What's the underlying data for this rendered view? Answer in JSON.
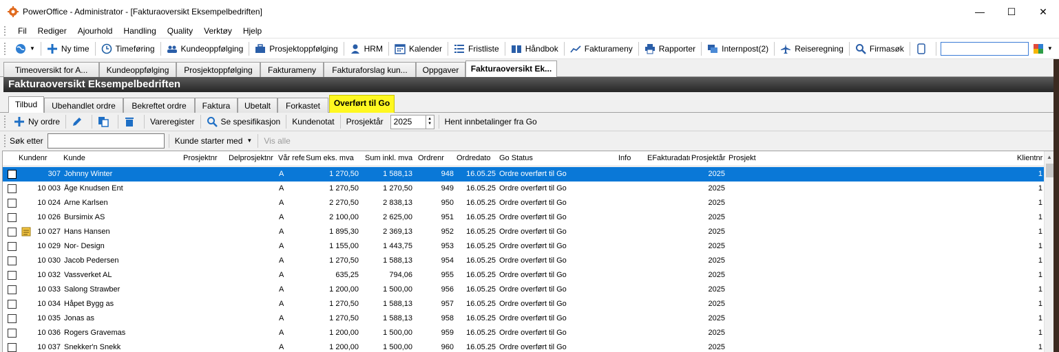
{
  "window": {
    "title": "PowerOffice - Administrator - [Fakturaoversikt Eksempelbedriften]",
    "minimize": "—",
    "maximize": "☐",
    "close": "✕"
  },
  "menu": [
    "Fil",
    "Rediger",
    "Ajourhold",
    "Handling",
    "Quality",
    "Verktøy",
    "Hjelp"
  ],
  "toolbar": {
    "items": [
      {
        "label": "Ny time",
        "icon": "plus-icon"
      },
      {
        "label": "Timeføring",
        "icon": "clock-icon"
      },
      {
        "label": "Kundeoppfølging",
        "icon": "people-icon"
      },
      {
        "label": "Prosjektoppfølging",
        "icon": "briefcase-icon"
      },
      {
        "label": "HRM",
        "icon": "person-icon"
      },
      {
        "label": "Kalender",
        "icon": "calendar-icon"
      },
      {
        "label": "Fristliste",
        "icon": "list-icon"
      },
      {
        "label": "Håndbok",
        "icon": "book-icon"
      },
      {
        "label": "Fakturameny",
        "icon": "chart-icon"
      },
      {
        "label": "Rapporter",
        "icon": "printer-icon"
      },
      {
        "label": "Internpost(2)",
        "icon": "chat-icon"
      },
      {
        "label": "Reiseregning",
        "icon": "plane-icon"
      },
      {
        "label": "Firmasøk",
        "icon": "search-icon"
      }
    ],
    "search_value": ""
  },
  "doc_tabs": [
    "Timeoversikt for A...",
    "Kundeoppfølging",
    "Prosjektoppfølging",
    "Fakturameny",
    "Fakturaforslag kun...",
    "Oppgaver",
    "Fakturaoversikt Ek..."
  ],
  "header_title": "Fakturaoversikt Eksempelbedriften",
  "sub_tabs": [
    "Tilbud",
    "Ubehandlet ordre",
    "Bekreftet ordre",
    "Faktura",
    "Ubetalt",
    "Forkastet",
    "Overført til Go"
  ],
  "toolbar2": {
    "new_order": "Ny ordre",
    "vareregister": "Vareregister",
    "se_spesifikasjon": "Se spesifikasjon",
    "kundenotat": "Kundenotat",
    "prosjektar_label": "Prosjektår",
    "prosjektar_value": "2025",
    "hent": "Hent innbetalinger fra Go"
  },
  "searchbar": {
    "label": "Søk etter",
    "value": "",
    "filter": "Kunde starter med",
    "vis_alle": "Vis alle"
  },
  "columns": [
    "Kundenr",
    "Kunde",
    "Prosjektnr",
    "Delprosjektnr",
    "Vår refe",
    "Sum eks. mva",
    "Sum inkl. mva",
    "Ordrenr",
    "Ordredato",
    "Go Status",
    "Info",
    "EFakturadato",
    "Prosjektår",
    "Prosjekt",
    "Klientnr"
  ],
  "rows": [
    {
      "kundenr": "307",
      "kunde": "Johnny Winter",
      "ref": "A",
      "eks": "1 270,50",
      "inkl": "1 588,13",
      "ordrenr": "948",
      "dato": "16.05.25",
      "status": "Ordre overført til Go",
      "aar": "2025",
      "klient": "1"
    },
    {
      "kundenr": "10 003",
      "kunde": "Åge Knudsen Ent",
      "ref": "A",
      "eks": "1 270,50",
      "inkl": "1 270,50",
      "ordrenr": "949",
      "dato": "16.05.25",
      "status": "Ordre overført til Go",
      "aar": "2025",
      "klient": "1"
    },
    {
      "kundenr": "10 024",
      "kunde": "Arne Karlsen",
      "ref": "A",
      "eks": "2 270,50",
      "inkl": "2 838,13",
      "ordrenr": "950",
      "dato": "16.05.25",
      "status": "Ordre overført til Go",
      "aar": "2025",
      "klient": "1"
    },
    {
      "kundenr": "10 026",
      "kunde": "Bursimix AS",
      "ref": "A",
      "eks": "2 100,00",
      "inkl": "2 625,00",
      "ordrenr": "951",
      "dato": "16.05.25",
      "status": "Ordre overført til Go",
      "aar": "2025",
      "klient": "1"
    },
    {
      "kundenr": "10 027",
      "kunde": "Hans Hansen",
      "ref": "A",
      "eks": "1 895,30",
      "inkl": "2 369,13",
      "ordrenr": "952",
      "dato": "16.05.25",
      "status": "Ordre overført til Go",
      "aar": "2025",
      "klient": "1",
      "note": true
    },
    {
      "kundenr": "10 029",
      "kunde": "Nor- Design",
      "ref": "A",
      "eks": "1 155,00",
      "inkl": "1 443,75",
      "ordrenr": "953",
      "dato": "16.05.25",
      "status": "Ordre overført til Go",
      "aar": "2025",
      "klient": "1"
    },
    {
      "kundenr": "10 030",
      "kunde": "Jacob Pedersen",
      "ref": "A",
      "eks": "1 270,50",
      "inkl": "1 588,13",
      "ordrenr": "954",
      "dato": "16.05.25",
      "status": "Ordre overført til Go",
      "aar": "2025",
      "klient": "1"
    },
    {
      "kundenr": "10 032",
      "kunde": "Vassverket AL",
      "ref": "A",
      "eks": "635,25",
      "inkl": "794,06",
      "ordrenr": "955",
      "dato": "16.05.25",
      "status": "Ordre overført til Go",
      "aar": "2025",
      "klient": "1"
    },
    {
      "kundenr": "10 033",
      "kunde": "Salong Strawber",
      "ref": "A",
      "eks": "1 200,00",
      "inkl": "1 500,00",
      "ordrenr": "956",
      "dato": "16.05.25",
      "status": "Ordre overført til Go",
      "aar": "2025",
      "klient": "1"
    },
    {
      "kundenr": "10 034",
      "kunde": "Håpet Bygg as",
      "ref": "A",
      "eks": "1 270,50",
      "inkl": "1 588,13",
      "ordrenr": "957",
      "dato": "16.05.25",
      "status": "Ordre overført til Go",
      "aar": "2025",
      "klient": "1"
    },
    {
      "kundenr": "10 035",
      "kunde": "Jonas as",
      "ref": "A",
      "eks": "1 270,50",
      "inkl": "1 588,13",
      "ordrenr": "958",
      "dato": "16.05.25",
      "status": "Ordre overført til Go",
      "aar": "2025",
      "klient": "1"
    },
    {
      "kundenr": "10 036",
      "kunde": "Rogers Gravemas",
      "ref": "A",
      "eks": "1 200,00",
      "inkl": "1 500,00",
      "ordrenr": "959",
      "dato": "16.05.25",
      "status": "Ordre overført til Go",
      "aar": "2025",
      "klient": "1"
    },
    {
      "kundenr": "10 037",
      "kunde": "Snekker'n Snekk",
      "ref": "A",
      "eks": "1 200,00",
      "inkl": "1 500,00",
      "ordrenr": "960",
      "dato": "16.05.25",
      "status": "Ordre overført til Go",
      "aar": "2025",
      "klient": "1"
    }
  ],
  "colors": {
    "selected_row": "#0a78d7",
    "highlight_tab": "#fff820",
    "header_bar": "#262626"
  }
}
